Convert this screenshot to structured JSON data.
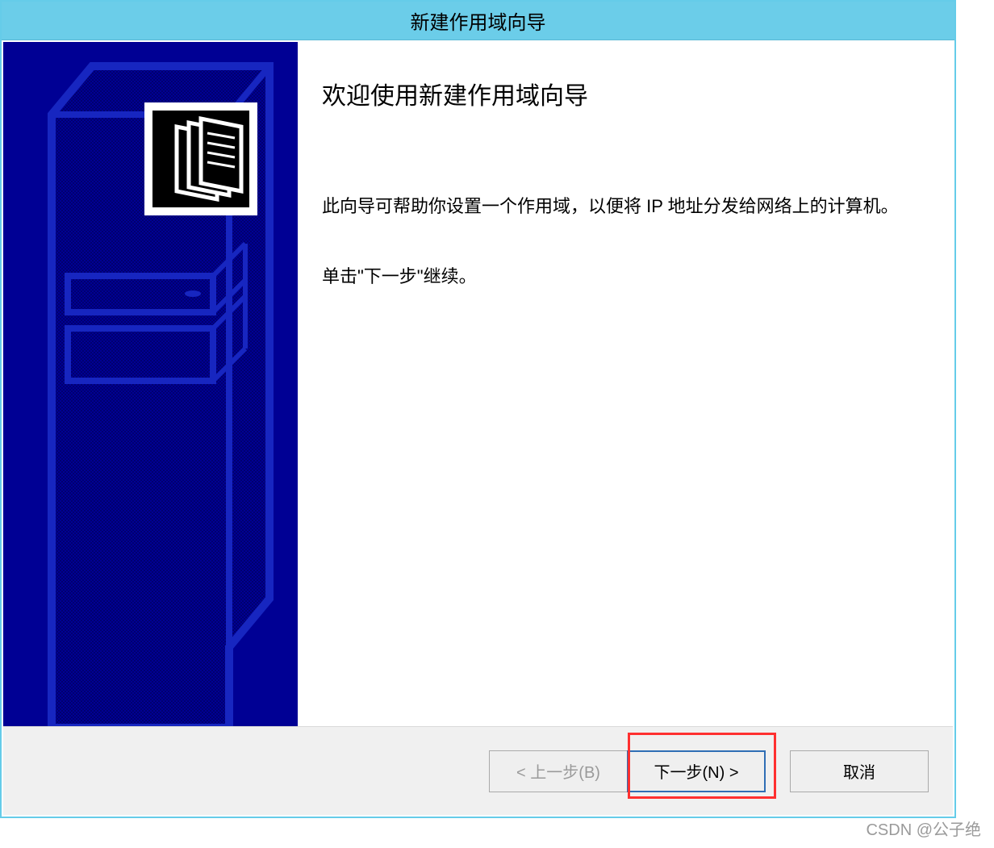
{
  "titlebar": {
    "title": "新建作用域向导"
  },
  "content": {
    "heading": "欢迎使用新建作用域向导",
    "para1": "此向导可帮助你设置一个作用域，以便将 IP 地址分发给网络上的计算机。",
    "para2": "单击\"下一步\"继续。"
  },
  "buttons": {
    "back": "< 上一步(B)",
    "next": "下一步(N) >",
    "cancel": "取消"
  },
  "watermark": "CSDN @公子绝"
}
